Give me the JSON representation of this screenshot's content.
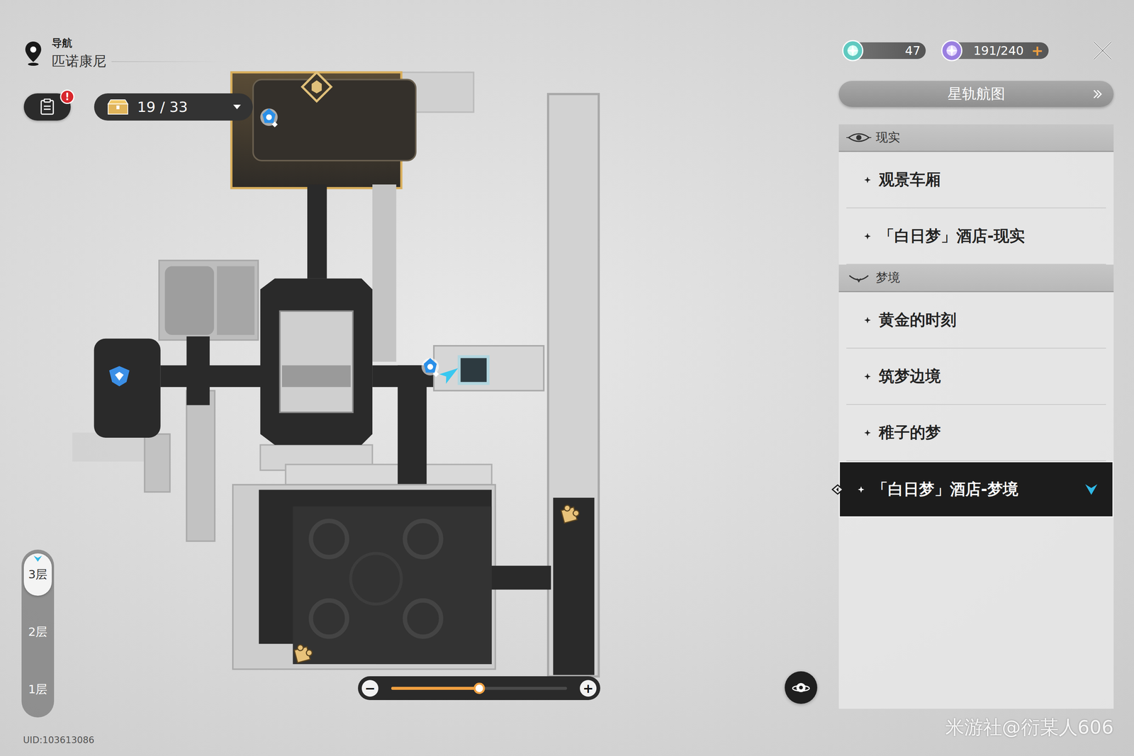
{
  "header": {
    "label": "导航",
    "location": "匹诺康尼"
  },
  "quest_button": {
    "badge": "!"
  },
  "chest_counter": {
    "count": "19 / 33"
  },
  "resources": [
    {
      "kind": "fuel",
      "value": "47",
      "add": ""
    },
    {
      "kind": "power",
      "value": "191/240",
      "add": "+"
    }
  ],
  "star_rail_map_button": {
    "label": "星轨航图"
  },
  "sections": [
    {
      "kind": "reality",
      "title": "现实",
      "items": [
        {
          "label": "观景车厢",
          "selected": false
        },
        {
          "label": "「白日梦」酒店-现实",
          "selected": false
        }
      ]
    },
    {
      "kind": "dream",
      "title": "梦境",
      "items": [
        {
          "label": "黄金的时刻",
          "selected": false
        },
        {
          "label": "筑梦边境",
          "selected": false
        },
        {
          "label": "稚子的梦",
          "selected": false
        },
        {
          "label": "「白日梦」酒店-梦境",
          "selected": true
        }
      ]
    }
  ],
  "floors": [
    {
      "label": "3层",
      "selected": true
    },
    {
      "label": "2层",
      "selected": false
    },
    {
      "label": "1层",
      "selected": false
    }
  ],
  "zoom": {
    "level": 0.5,
    "minus": "−",
    "plus": "+"
  },
  "uid": "UID:103613086",
  "watermark": "米游社@衍某人606"
}
